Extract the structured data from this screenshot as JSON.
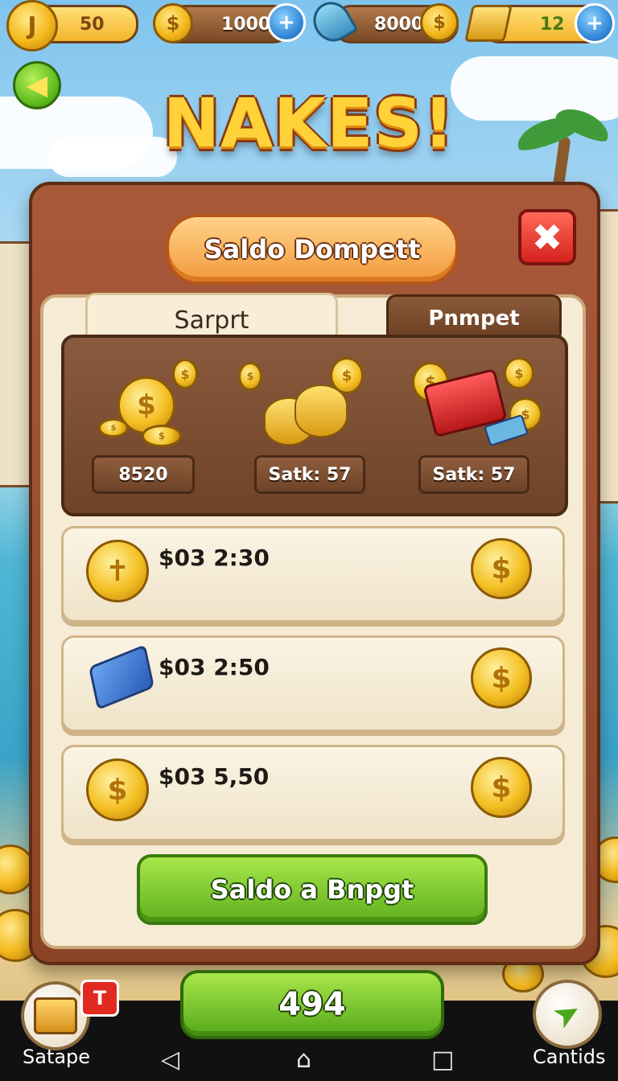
{
  "top_bar": {
    "resources": [
      {
        "name": "coins",
        "value": "50"
      },
      {
        "name": "gold",
        "value": "1000"
      },
      {
        "name": "shells",
        "value": "8000"
      },
      {
        "name": "bars",
        "value": "12"
      }
    ]
  },
  "game_logo": "NAKES!",
  "dialog": {
    "title": "Saldo Dompett",
    "tabs": [
      {
        "label": "Sarprt",
        "active": true
      },
      {
        "label": "Pnmpet",
        "active": false
      }
    ],
    "summary": [
      {
        "label": "8520"
      },
      {
        "label": "Satk: 57"
      },
      {
        "label": "Satk: 57"
      }
    ],
    "rows": [
      {
        "text": "$03 2:30"
      },
      {
        "text": "$03 2:50"
      },
      {
        "text": "$03 5,50"
      }
    ],
    "action_label": "Saldo a Bnpgt"
  },
  "bottom": {
    "left_label": "Satape",
    "left_badge": "T",
    "score": "494",
    "right_label": "Cantids"
  },
  "colors": {
    "panel": "#8c4426",
    "accent_green": "#5fb01e",
    "close_red": "#d4221c",
    "coin_gold": "#f4bf22"
  }
}
